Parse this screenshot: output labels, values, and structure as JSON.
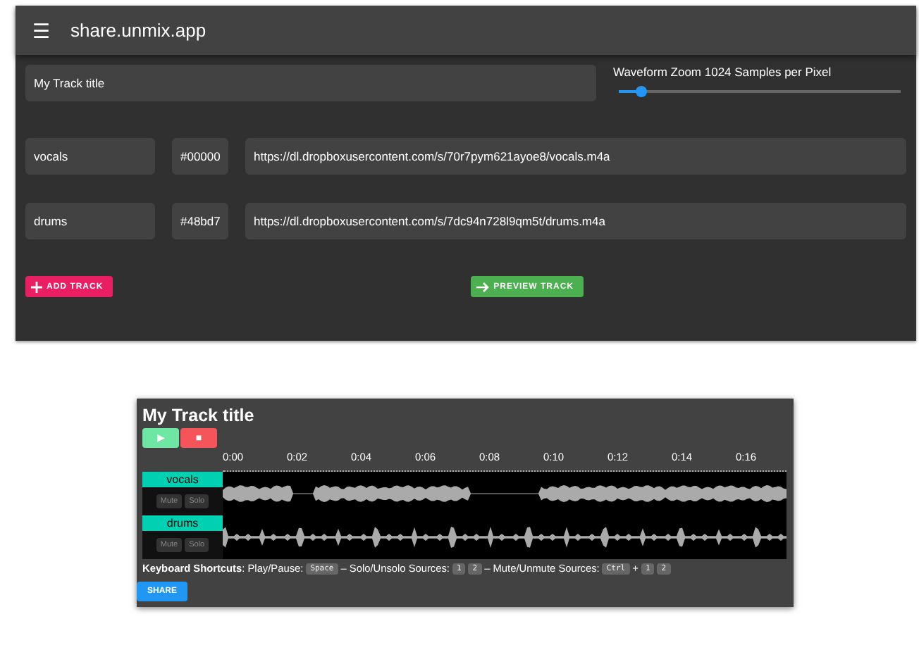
{
  "app_bar": {
    "menu_glyph": "☰",
    "title": "share.unmix.app"
  },
  "title_field": {
    "value": "My Track title"
  },
  "zoom": {
    "label": "Waveform Zoom 1024 Samples per Pixel",
    "level": 0.08
  },
  "tracks": [
    {
      "name": "vocals",
      "hex_value": "#00000",
      "url": "https://dl.dropboxusercontent.com/s/70r7pym621ayoe8/vocals.m4a"
    },
    {
      "name": "drums",
      "hex_value": "#48bd7",
      "url": "https://dl.dropboxusercontent.com/s/7dc94n728l9qm5t/drums.m4a"
    }
  ],
  "buttons": {
    "add": "ADD TRACK",
    "preview": "PREVIEW TRACK"
  },
  "preview": {
    "title": "My Track title",
    "play_glyph": "▶",
    "stop_glyph": "■",
    "times": [
      "0:00",
      "0:02",
      "0:04",
      "0:06",
      "0:08",
      "0:10",
      "0:12",
      "0:14",
      "0:16"
    ],
    "tracks": [
      {
        "name": "vocals",
        "mute": "Mute",
        "solo": "Solo",
        "kind": "vocal"
      },
      {
        "name": "drums",
        "mute": "Mute",
        "solo": "Solo",
        "kind": "drum"
      }
    ],
    "shortcuts": [
      {
        "kind": "label",
        "text": "Keyboard Shortcuts"
      },
      {
        "kind": "text",
        "text": ": Play/Pause:"
      },
      {
        "kind": "key",
        "text": "Space"
      },
      {
        "kind": "text",
        "text": "– Solo/Unsolo Sources:"
      },
      {
        "kind": "key",
        "text": "1"
      },
      {
        "kind": "key",
        "text": "2"
      },
      {
        "kind": "text",
        "text": "– Mute/Unmute Sources:"
      },
      {
        "kind": "key",
        "text": "Ctrl"
      },
      {
        "kind": "text",
        "text": "+"
      },
      {
        "kind": "key",
        "text": "1"
      },
      {
        "kind": "key",
        "text": "2"
      }
    ],
    "share": "SHARE"
  }
}
